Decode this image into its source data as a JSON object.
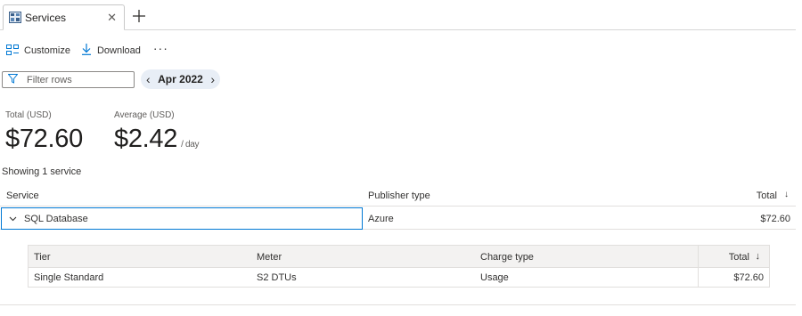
{
  "tab": {
    "title": "Services",
    "close": "✕",
    "add": "+"
  },
  "toolbar": {
    "customize": "Customize",
    "download": "Download",
    "more": "···"
  },
  "filter": {
    "placeholder": "Filter rows",
    "value": ""
  },
  "date_picker": {
    "label": "Apr 2022",
    "prev": "‹",
    "next": "›"
  },
  "kpis": {
    "total": {
      "label": "Total (USD)",
      "value": "$72.60"
    },
    "average": {
      "label": "Average (USD)",
      "value": "$2.42",
      "unit": "/ day"
    }
  },
  "showing_text": "Showing 1 service",
  "grid": {
    "columns": {
      "service": "Service",
      "publisher": "Publisher type",
      "total": "Total",
      "sort": "↓"
    },
    "rows": [
      {
        "service": "SQL Database",
        "publisher": "Azure",
        "total": "$72.60"
      }
    ]
  },
  "subgrid": {
    "columns": {
      "tier": "Tier",
      "meter": "Meter",
      "charge_type": "Charge type",
      "total": "Total",
      "sort": "↓"
    },
    "rows": [
      {
        "tier": "Single Standard",
        "meter": "S2 DTUs",
        "charge_type": "Usage",
        "total": "$72.60"
      }
    ]
  },
  "colors": {
    "accent": "#0078d4",
    "pill_bg": "#e8eef6"
  },
  "icons": [
    "services-icon",
    "close-icon",
    "add-icon",
    "customize-icon",
    "download-icon",
    "more-icon",
    "filter-icon",
    "chevron-left-icon",
    "chevron-right-icon",
    "chevron-down-icon",
    "sort-down-icon"
  ]
}
